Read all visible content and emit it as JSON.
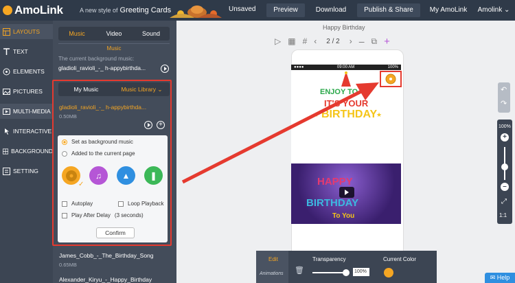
{
  "topbar": {
    "logo": "AmoLink",
    "tagline": "A new style of",
    "tagline_product": "Greeting Cards",
    "unsaved": "Unsaved",
    "preview": "Preview",
    "download": "Download",
    "publish": "Publish & Share",
    "my_amolink": "My AmoLink",
    "user": "Amolink"
  },
  "nav": {
    "items": [
      {
        "label": "LAYOUTS",
        "icon": "layouts-icon"
      },
      {
        "label": "TEXT",
        "icon": "text-icon"
      },
      {
        "label": "ELEMENTS",
        "icon": "elements-icon"
      },
      {
        "label": "PICTURES",
        "icon": "pictures-icon"
      },
      {
        "label": "MULTI-MEDIA",
        "icon": "multimedia-icon"
      },
      {
        "label": "INTERACTIVE",
        "icon": "interactive-icon"
      },
      {
        "label": "BACKGROUND",
        "icon": "background-icon"
      },
      {
        "label": "SETTING",
        "icon": "setting-icon"
      }
    ]
  },
  "panel": {
    "tabs": [
      "Music",
      "Video",
      "Sound"
    ],
    "section_title": "Music",
    "bg_caption": "The current background music:",
    "bg_file": "gladioli_ravioli_-_ h-appybirthda...",
    "sub_tabs": [
      "My Music",
      "Music Library"
    ],
    "lib_file": "gladioli_ravioli_-_ h-appybirthda...",
    "lib_size": "0.50MB",
    "popup": {
      "radio_bg": "Set as background music",
      "radio_page": "Added to the current page",
      "autoplay": "Autoplay",
      "loop": "Loop Playback",
      "play_delay": "Play After Delay",
      "delay_value": "(3 seconds)",
      "confirm": "Confirm"
    },
    "songs": [
      {
        "name": "James_Cobb_-_The_Birthday_Song",
        "size": "0.65MB"
      },
      {
        "name": "Alexander_Kiryu_-_Happy_Birthday",
        "size": ""
      }
    ]
  },
  "canvas": {
    "page_title": "Happy Birthday",
    "page_indicator": "2 / 2",
    "status_time": "09:00 AM",
    "status_battery": "100%",
    "card_line1": "ENJOY TO",
    "card_line2": "IT'S YOUR",
    "card_line3": "BIRTHDAY",
    "img_happy": "HAPPY",
    "img_birthday": "BIRTHDAY",
    "img_to_you": "To You"
  },
  "zoom": {
    "percent": "100%",
    "ratio": "1:1"
  },
  "bottombar": {
    "edit": "Edit",
    "animations": "Animations",
    "transparency": "Transparency",
    "transparency_value": "100%",
    "current_color": "Current Color"
  },
  "help": "Help",
  "colors": {
    "accent": "#f5a623",
    "topbar": "#2f3a49",
    "highlight": "#e53a2f",
    "current_color": "#f5a623"
  }
}
